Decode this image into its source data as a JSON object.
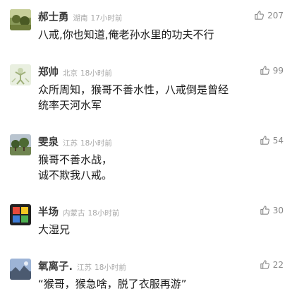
{
  "comments": [
    {
      "username": "郝士勇",
      "location": "湖南",
      "time": "17小时前",
      "likes": "207",
      "text": "八戒,你也知道,俺老孙水里的功夫不行",
      "avatar_icon": "avatar-landscape-icon"
    },
    {
      "username": "郑帅",
      "location": "北京",
      "time": "18小时前",
      "likes": "99",
      "text": "众所周知，猴哥不善水性，八戒倒是曾经统率天河水军",
      "avatar_icon": "avatar-figure-icon"
    },
    {
      "username": "雯泉",
      "location": "江苏",
      "time": "18小时前",
      "likes": "54",
      "text": "猴哥不善水战，\n诚不欺我八戒。",
      "avatar_icon": "avatar-trees-icon"
    },
    {
      "username": "半场",
      "location": "内蒙古",
      "time": "18小时前",
      "likes": "30",
      "text": "大湿兄",
      "avatar_icon": "avatar-colorblocks-icon"
    },
    {
      "username": "氧离子.",
      "location": "江苏",
      "time": "18小时前",
      "likes": "22",
      "text": "“猴哥，猴急啥，脱了衣服再游”",
      "avatar_icon": "avatar-sky-icon"
    }
  ],
  "colors": {
    "username": "#3d3d3d",
    "meta": "#a8a8a8",
    "text": "#1a1a1a",
    "like": "#888888"
  },
  "icons": {
    "like": "thumbs-up-icon"
  }
}
